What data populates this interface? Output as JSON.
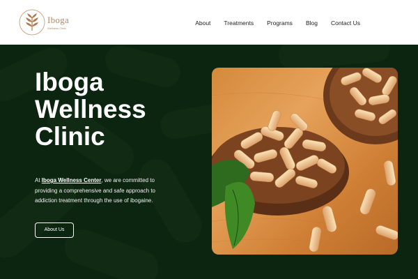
{
  "brand": {
    "logo_word": "Iboga",
    "logo_sub": "Wellness Clinic"
  },
  "nav": {
    "items": [
      "About",
      "Treatments",
      "Programs",
      "Blog",
      "Contact Us"
    ]
  },
  "hero": {
    "title_line1": "Iboga",
    "title_line2": "Wellness",
    "title_line3": "Clinic",
    "desc_prefix": "At ",
    "desc_brand": "Iboga Wellness Center",
    "desc_rest": ", we are committed to providing a comprehensive and safe approach to addiction treatment through the use of ibogaine.",
    "button_label": "About Us"
  },
  "colors": {
    "hero_bg": "#0f2b14",
    "logo_accent": "#b08a6a",
    "capsule": "#f0c690"
  },
  "icons": {
    "logo": "leaf-tree-icon"
  }
}
